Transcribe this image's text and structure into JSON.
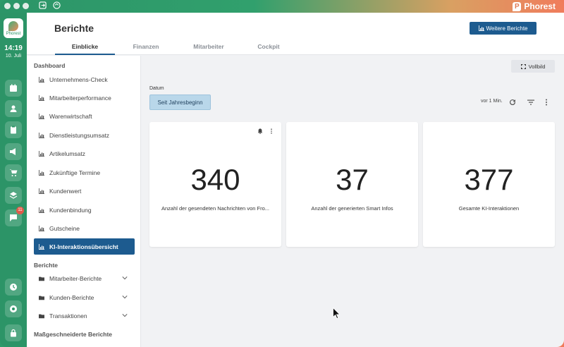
{
  "brand": {
    "name": "Phorest",
    "logo_text": "Phorest"
  },
  "rail": {
    "time": "14:19",
    "date": "10. Juli",
    "badge_count": "11"
  },
  "header": {
    "title": "Berichte",
    "more_button": "Weitere Berichte",
    "tabs": [
      {
        "label": "Einblicke",
        "active": true
      },
      {
        "label": "Finanzen",
        "active": false
      },
      {
        "label": "Mitarbeiter",
        "active": false
      },
      {
        "label": "Cockpit",
        "active": false
      }
    ]
  },
  "sidebar": {
    "dashboard_heading": "Dashboard",
    "dashboard_items": [
      "Unternehmens-Check",
      "Mitarbeiterperformance",
      "Warenwirtschaft",
      "Dienstleistungsumsatz",
      "Artikelumsatz",
      "Zukünftige Termine",
      "Kundenwert",
      "Kundenbindung",
      "Gutscheine",
      "KI-Interaktionsübersicht"
    ],
    "active_item": "KI-Interaktionsübersicht",
    "reports_heading": "Berichte",
    "report_groups": [
      "Mitarbeiter-Berichte",
      "Kunden-Berichte",
      "Transaktionen"
    ],
    "custom_heading": "Maßgeschneiderte Berichte"
  },
  "content": {
    "fullscreen_label": "Vollbild",
    "date_label": "Datum",
    "date_value": "Seit Jahresbeginn",
    "refresh_text": "vor 1 Min.",
    "cards": [
      {
        "value": "340",
        "label": "Anzahl der gesendeten Nachrichten von Fro..."
      },
      {
        "value": "37",
        "label": "Anzahl der generierten Smart Infos"
      },
      {
        "value": "377",
        "label": "Gesamte KI-Interaktionen"
      }
    ]
  },
  "colors": {
    "primary": "#1d5b8f",
    "rail": "#2c9467",
    "chip": "#b9d7ea"
  }
}
